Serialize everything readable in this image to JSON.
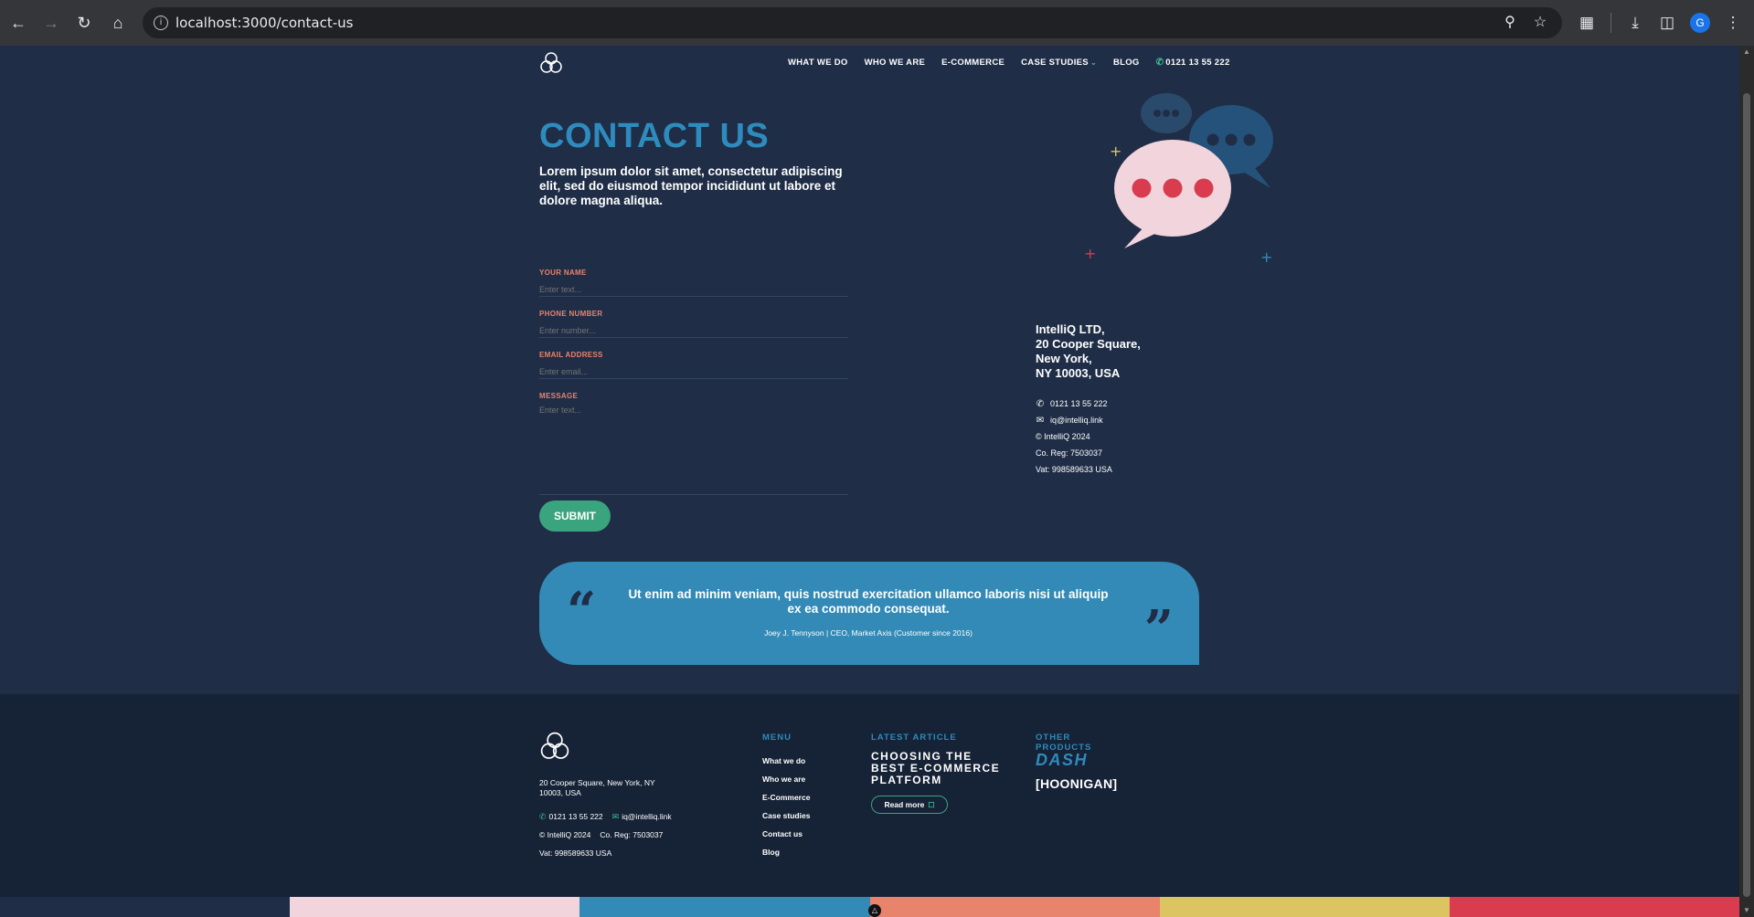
{
  "browser": {
    "url": "localhost:3000/contact-us",
    "profile_initial": "G"
  },
  "nav": {
    "items": [
      "WHAT WE DO",
      "WHO WE ARE",
      "E-COMMERCE",
      "CASE STUDIES",
      "BLOG"
    ],
    "phone": "0121 13 55 222"
  },
  "hero": {
    "title": "CONTACT US",
    "subtitle": "Lorem ipsum dolor sit amet, consectetur adipiscing elit, sed do eiusmod tempor incididunt ut labore et dolore magna aliqua."
  },
  "form": {
    "name_label": "YOUR NAME",
    "name_placeholder": "Enter text...",
    "phone_label": "PHONE NUMBER",
    "phone_placeholder": "Enter number...",
    "email_label": "EMAIL ADDRESS",
    "email_placeholder": "Enter email...",
    "message_label": "MESSAGE",
    "message_placeholder": "Enter text...",
    "submit_label": "SUBMIT"
  },
  "address": {
    "line1": "IntelliQ LTD,",
    "line2": "20 Cooper Square,",
    "line3": "New York,",
    "line4": "NY 10003, USA",
    "phone": "0121 13 55 222",
    "email": "iq@intelliq.link",
    "copyright": "© IntelliQ 2024",
    "co_reg": "Co. Reg: 7503037",
    "vat": "Vat: 998589633 USA"
  },
  "testimonial": {
    "quote": "Ut enim ad minim veniam, quis nostrud exercitation ullamco laboris nisi ut aliquip ex ea commodo consequat.",
    "author": "Joey J. Tennyson | CEO, Market Axis (Customer since 2016)"
  },
  "footer": {
    "address": "20 Cooper Square, New York, NY 10003, USA",
    "phone": "0121 13 55 222",
    "email": "iq@intelliq.link",
    "copyright": "© IntelliQ 2024",
    "co_reg": "Co. Reg: 7503037",
    "vat": "Vat: 998589633 USA",
    "menu_title": "MENU",
    "menu_items": [
      "What we do",
      "Who we are",
      "E-Commerce",
      "Case studies",
      "Contact us",
      "Blog"
    ],
    "article_title": "LATEST ARTICLE",
    "article_heading": "CHOOSING THE BEST E-COMMERCE PLATFORM",
    "read_more": "Read more",
    "other_title": "OTHER PRODUCTS",
    "product1": "DASH",
    "product2": "[HOONIGAN]"
  },
  "colors": {
    "page_bg": "#1f2d47",
    "footer_bg": "#162236",
    "accent_blue": "#2e8bbd",
    "accent_green": "#3aa47e",
    "label_orange": "#e8836c",
    "stripe": [
      "#1f2d47",
      "#f2d4dd",
      "#338ab6",
      "#e8836c",
      "#dcc463",
      "#d93b4f"
    ]
  }
}
